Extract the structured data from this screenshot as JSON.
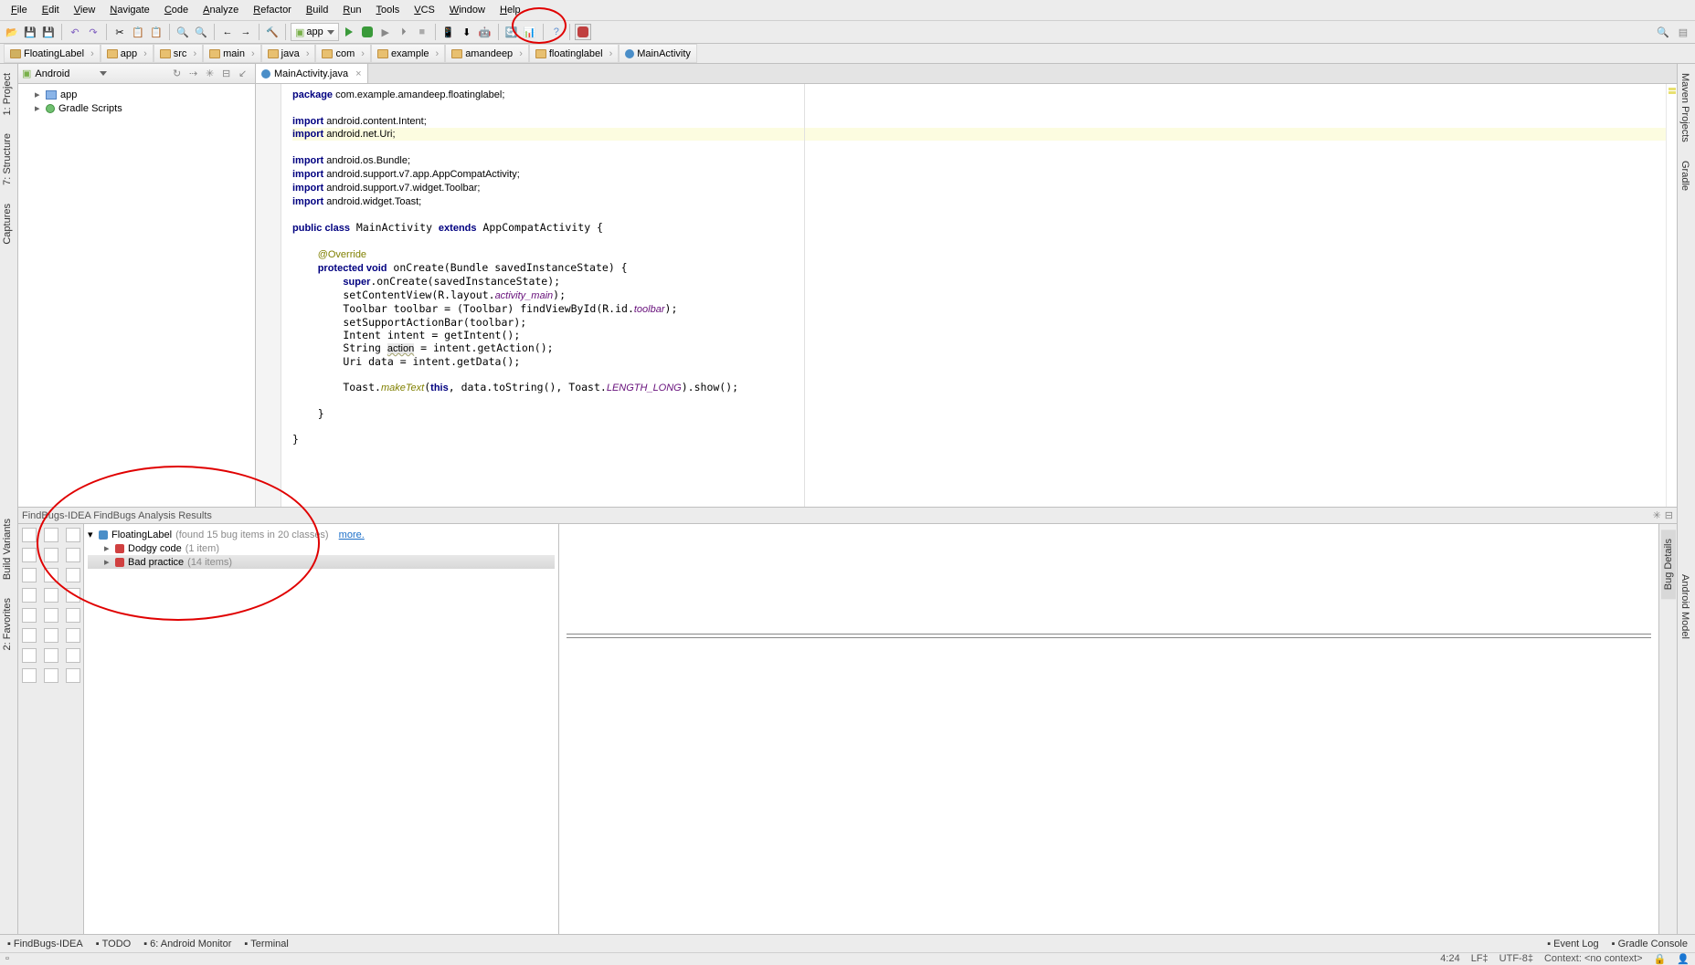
{
  "menu": [
    "File",
    "Edit",
    "View",
    "Navigate",
    "Code",
    "Analyze",
    "Refactor",
    "Build",
    "Run",
    "Tools",
    "VCS",
    "Window",
    "Help"
  ],
  "run_config": "app",
  "breadcrumb": [
    "FloatingLabel",
    "app",
    "src",
    "main",
    "java",
    "com",
    "example",
    "amandeep",
    "floatinglabel",
    "MainActivity"
  ],
  "proj_panel": {
    "title": "Android",
    "items": [
      "app",
      "Gradle Scripts"
    ]
  },
  "editor_tab": "MainActivity.java",
  "code_lines": [
    {
      "t": "package com.example.amandeep.floatinglabel;",
      "pkg": true
    },
    {
      "t": ""
    },
    {
      "import": "android.content.Intent"
    },
    {
      "import": "android.net.Uri",
      "hl": true
    },
    {
      "import": "android.os.Bundle"
    },
    {
      "import": "android.support.v7.app.AppCompatActivity"
    },
    {
      "import": "android.support.v7.widget.Toolbar"
    },
    {
      "import": "android.widget.Toast"
    },
    {
      "t": ""
    },
    {
      "classdecl": true
    },
    {
      "t": ""
    },
    {
      "t": "    ",
      "ann": "@Override"
    },
    {
      "method": true
    },
    {
      "t": "        super.onCreate(savedInstanceState);",
      "plain": true,
      "kwsuper": true
    },
    {
      "scv": true
    },
    {
      "tb": true
    },
    {
      "t": "        setSupportActionBar(toolbar);",
      "plain": true
    },
    {
      "t": "        Intent intent = getIntent();",
      "plain": true
    },
    {
      "action": true
    },
    {
      "t": "        Uri data = intent.getData();",
      "plain": true
    },
    {
      "t": ""
    },
    {
      "toast": true
    },
    {
      "t": ""
    },
    {
      "t": "    }"
    },
    {
      "t": ""
    },
    {
      "t": "}"
    }
  ],
  "findbugs": {
    "panel_title": "FindBugs-IDEA FindBugs Analysis Results",
    "root": "FloatingLabel",
    "root_sub": "(found 15 bug items in 20 classes)",
    "more": "more.",
    "children": [
      {
        "name": "Dodgy code",
        "count": "(1 item)"
      },
      {
        "name": "Bad practice",
        "count": "(14 items)",
        "sel": true
      }
    ]
  },
  "bottom_tabs": [
    "FindBugs-IDEA",
    "TODO",
    "6: Android Monitor",
    "Terminal"
  ],
  "bottom_right": [
    "Event Log",
    "Gradle Console"
  ],
  "status": {
    "pos": "4:24",
    "le": "LF‡",
    "enc": "UTF-8‡",
    "ctx": "Context: <no context>"
  },
  "right_tools": [
    "Maven Projects",
    "Gradle"
  ],
  "right_tools2": [
    "Android Model"
  ],
  "left_tools": [
    "1: Project",
    "7: Structure",
    "Captures"
  ],
  "left_tools2": [
    "Build Variants",
    "2: Favorites"
  ],
  "fb_right_label": "Bug Details"
}
